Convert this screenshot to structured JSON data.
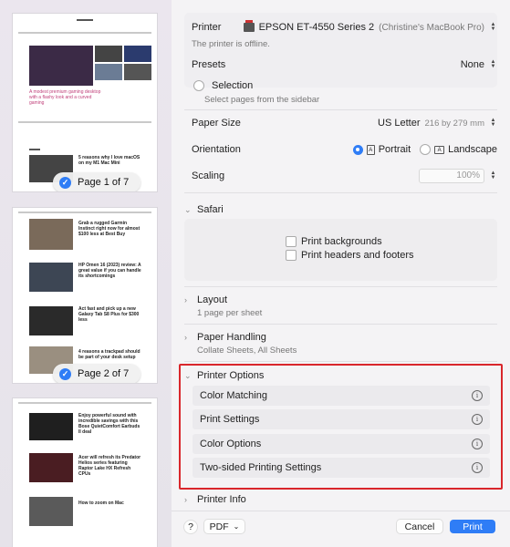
{
  "sidebar": {
    "pages": [
      {
        "badge": "Page 1 of 7"
      },
      {
        "badge": "Page 2 of 7"
      },
      {
        "badge": ""
      }
    ]
  },
  "printer": {
    "label": "Printer",
    "value": "EPSON ET-4550 Series 2",
    "owner": "(Christine's MacBook Pro)",
    "status": "The printer is offline."
  },
  "presets": {
    "label": "Presets",
    "value": "None"
  },
  "selection": {
    "label": "Selection",
    "note": "Select pages from the sidebar"
  },
  "paper_size": {
    "label": "Paper Size",
    "value": "US Letter",
    "dims": "216 by 279 mm"
  },
  "orientation": {
    "label": "Orientation",
    "portrait": "Portrait",
    "landscape": "Landscape"
  },
  "scaling": {
    "label": "Scaling",
    "value": "100%"
  },
  "safari": {
    "title": "Safari",
    "print_backgrounds": "Print backgrounds",
    "print_headers": "Print headers and footers"
  },
  "layout": {
    "title": "Layout",
    "summary": "1 page per sheet"
  },
  "paper_handling": {
    "title": "Paper Handling",
    "summary": "Collate Sheets, All Sheets"
  },
  "printer_options": {
    "title": "Printer Options",
    "items": [
      "Color Matching",
      "Print Settings",
      "Color Options",
      "Two-sided Printing Settings"
    ]
  },
  "printer_info": {
    "title": "Printer Info"
  },
  "footer": {
    "help": "?",
    "pdf": "PDF",
    "cancel": "Cancel",
    "print": "Print"
  },
  "colors": {
    "accent": "#2f7df6",
    "highlight": "#d9262b"
  }
}
